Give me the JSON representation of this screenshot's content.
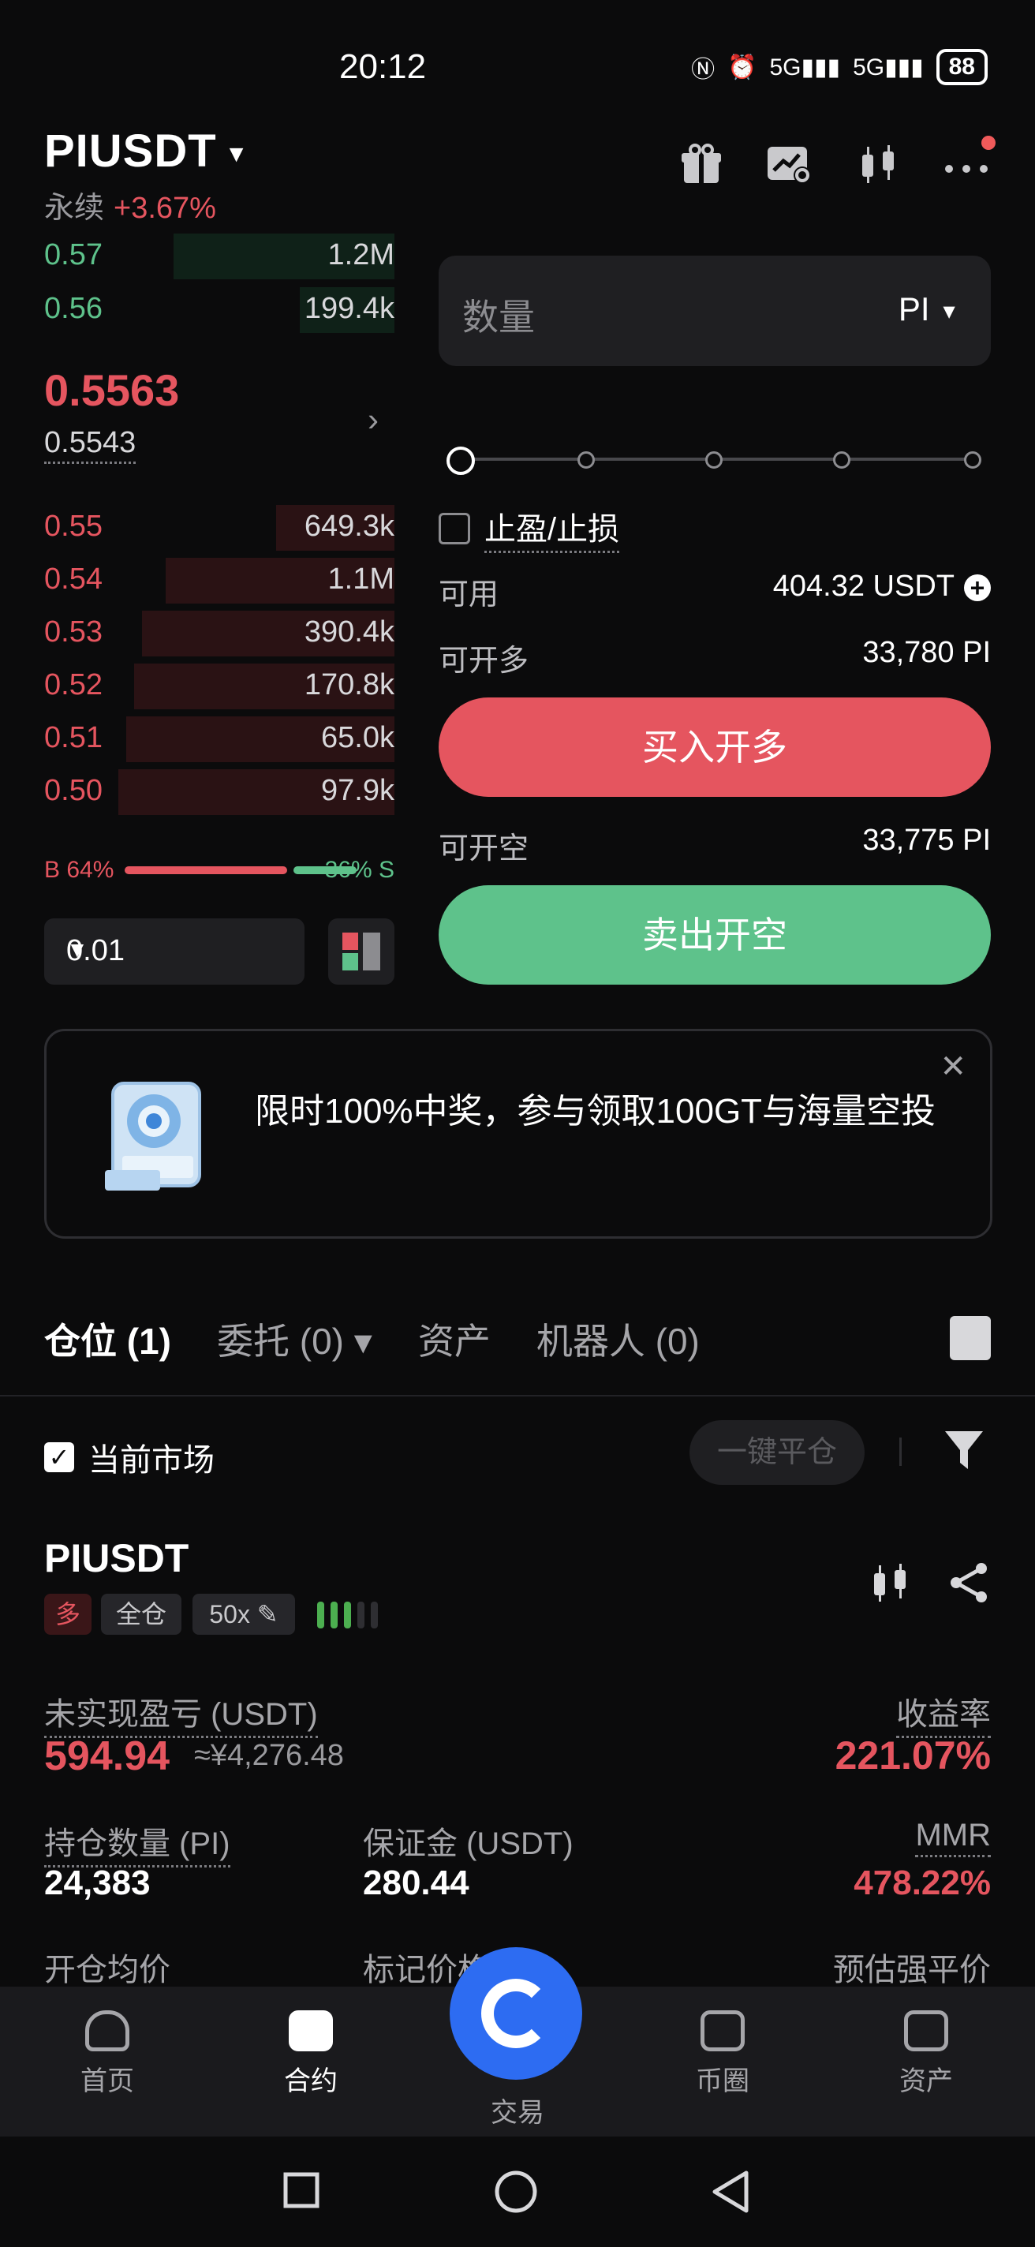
{
  "status_bar": {
    "time": "20:12",
    "signal1": "5G",
    "signal2": "5G",
    "battery": "88"
  },
  "header": {
    "pair": "PIUSDT",
    "type": "永续",
    "change": "+3.67%"
  },
  "orderbook": {
    "bids_top": [
      {
        "price": "0.57",
        "qty": "1.2M"
      },
      {
        "price": "0.56",
        "qty": "199.4k"
      }
    ],
    "last_price": "0.5563",
    "mark_price": "0.5543",
    "asks": [
      {
        "price": "0.55",
        "qty": "649.3k"
      },
      {
        "price": "0.54",
        "qty": "1.1M"
      },
      {
        "price": "0.53",
        "qty": "390.4k"
      },
      {
        "price": "0.52",
        "qty": "170.8k"
      },
      {
        "price": "0.51",
        "qty": "65.0k"
      },
      {
        "price": "0.50",
        "qty": "97.9k"
      }
    ],
    "buy_ratio_label": "B 64%",
    "sell_ratio_label": "36% S",
    "buy_ratio": 0.64,
    "precision": "0.01"
  },
  "order_form": {
    "qty_placeholder": "数量",
    "qty_unit": "PI",
    "tpsl_label": "止盈/止损",
    "available_label": "可用",
    "available_value": "404.32 USDT",
    "can_long_label": "可开多",
    "can_long_value": "33,780 PI",
    "buy_button": "买入开多",
    "can_short_label": "可开空",
    "can_short_value": "33,775 PI",
    "sell_button": "卖出开空"
  },
  "banner": {
    "text": "限时100%中奖，参与领取100GT与海量空投"
  },
  "tabs": [
    {
      "label": "仓位 (1)"
    },
    {
      "label": "委托 (0) ▾"
    },
    {
      "label": "资产"
    },
    {
      "label": "机器人 (0)"
    }
  ],
  "filters": {
    "current_market": "当前市场",
    "close_all": "一键平仓"
  },
  "position": {
    "symbol": "PIUSDT",
    "side": "多",
    "margin_mode": "全仓",
    "leverage": "50x",
    "upnl_label": "未实现盈亏 (USDT)",
    "upnl_value": "594.94",
    "upnl_cny": "≈¥4,276.48",
    "roe_label": "收益率",
    "roe_value": "221.07%",
    "size_label": "持仓数量 (PI)",
    "size_value": "24,383",
    "margin_label": "保证金 (USDT)",
    "margin_value": "280.44",
    "mmr_label": "MMR",
    "mmr_value": "478.22%",
    "entry_label": "开仓均价",
    "mark_label": "标记价格",
    "liq_label": "预估强平价"
  },
  "bottom_nav": [
    {
      "label": "首页"
    },
    {
      "label": "合约"
    },
    {
      "label": "交易"
    },
    {
      "label": "币圈"
    },
    {
      "label": "资产"
    }
  ]
}
